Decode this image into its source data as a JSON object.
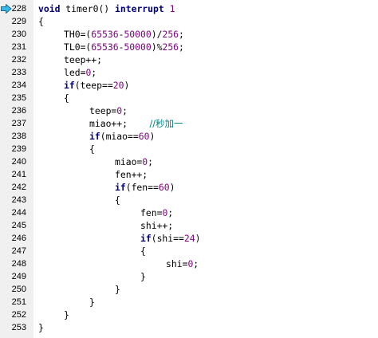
{
  "editor": {
    "current_line": "228",
    "marker_color": "#38b8e6",
    "colors": {
      "text": "#000000",
      "keyword": "#000080",
      "number": "#800080",
      "comment": "#008080",
      "gutter": "#f0f0f0"
    },
    "lines": [
      {
        "num": "228",
        "indent": 0,
        "segments": [
          {
            "t": "void",
            "c": "kw"
          },
          {
            "t": " timer0() "
          },
          {
            "t": "interrupt",
            "c": "kw"
          },
          {
            "t": " "
          },
          {
            "t": "1",
            "c": "num"
          }
        ]
      },
      {
        "num": "229",
        "indent": 0,
        "segments": [
          {
            "t": "{"
          }
        ]
      },
      {
        "num": "230",
        "indent": 1,
        "segments": [
          {
            "t": "TH0=("
          },
          {
            "t": "65536",
            "c": "num"
          },
          {
            "t": "-"
          },
          {
            "t": "50000",
            "c": "num"
          },
          {
            "t": ")/"
          },
          {
            "t": "256",
            "c": "num"
          },
          {
            "t": ";"
          }
        ]
      },
      {
        "num": "231",
        "indent": 1,
        "segments": [
          {
            "t": "TL0=("
          },
          {
            "t": "65536",
            "c": "num"
          },
          {
            "t": "-"
          },
          {
            "t": "50000",
            "c": "num"
          },
          {
            "t": ")%"
          },
          {
            "t": "256",
            "c": "num"
          },
          {
            "t": ";"
          }
        ]
      },
      {
        "num": "232",
        "indent": 1,
        "segments": [
          {
            "t": "teep++;"
          }
        ]
      },
      {
        "num": "233",
        "indent": 1,
        "segments": [
          {
            "t": "led="
          },
          {
            "t": "0",
            "c": "num"
          },
          {
            "t": ";"
          }
        ]
      },
      {
        "num": "234",
        "indent": 1,
        "segments": [
          {
            "t": "if",
            "c": "kw"
          },
          {
            "t": "(teep=="
          },
          {
            "t": "20",
            "c": "num"
          },
          {
            "t": ")"
          }
        ]
      },
      {
        "num": "235",
        "indent": 1,
        "segments": [
          {
            "t": "{"
          }
        ]
      },
      {
        "num": "236",
        "indent": 2,
        "segments": [
          {
            "t": "teep="
          },
          {
            "t": "0",
            "c": "num"
          },
          {
            "t": ";"
          }
        ]
      },
      {
        "num": "237",
        "indent": 2,
        "segments": [
          {
            "t": "miao++;    "
          },
          {
            "t": "//秒加一",
            "c": "cmt"
          }
        ]
      },
      {
        "num": "238",
        "indent": 2,
        "segments": [
          {
            "t": "if",
            "c": "kw"
          },
          {
            "t": "(miao=="
          },
          {
            "t": "60",
            "c": "num"
          },
          {
            "t": ")"
          }
        ]
      },
      {
        "num": "239",
        "indent": 2,
        "segments": [
          {
            "t": "{"
          }
        ]
      },
      {
        "num": "240",
        "indent": 3,
        "segments": [
          {
            "t": "miao="
          },
          {
            "t": "0",
            "c": "num"
          },
          {
            "t": ";"
          }
        ]
      },
      {
        "num": "241",
        "indent": 3,
        "segments": [
          {
            "t": "fen++;"
          }
        ]
      },
      {
        "num": "242",
        "indent": 3,
        "segments": [
          {
            "t": "if",
            "c": "kw"
          },
          {
            "t": "(fen=="
          },
          {
            "t": "60",
            "c": "num"
          },
          {
            "t": ")"
          }
        ]
      },
      {
        "num": "243",
        "indent": 3,
        "segments": [
          {
            "t": "{"
          }
        ]
      },
      {
        "num": "244",
        "indent": 4,
        "segments": [
          {
            "t": "fen="
          },
          {
            "t": "0",
            "c": "num"
          },
          {
            "t": ";"
          }
        ]
      },
      {
        "num": "245",
        "indent": 4,
        "segments": [
          {
            "t": "shi++;"
          }
        ]
      },
      {
        "num": "246",
        "indent": 4,
        "segments": [
          {
            "t": "if",
            "c": "kw"
          },
          {
            "t": "(shi=="
          },
          {
            "t": "24",
            "c": "num"
          },
          {
            "t": ")"
          }
        ]
      },
      {
        "num": "247",
        "indent": 4,
        "segments": [
          {
            "t": "{"
          }
        ]
      },
      {
        "num": "248",
        "indent": 5,
        "segments": [
          {
            "t": "shi="
          },
          {
            "t": "0",
            "c": "num"
          },
          {
            "t": ";"
          }
        ]
      },
      {
        "num": "249",
        "indent": 4,
        "segments": [
          {
            "t": "}"
          }
        ]
      },
      {
        "num": "250",
        "indent": 3,
        "segments": [
          {
            "t": "}"
          }
        ]
      },
      {
        "num": "251",
        "indent": 2,
        "segments": [
          {
            "t": "}"
          }
        ]
      },
      {
        "num": "252",
        "indent": 1,
        "segments": [
          {
            "t": "}"
          }
        ]
      },
      {
        "num": "253",
        "indent": 0,
        "segments": [
          {
            "t": "}"
          }
        ]
      }
    ]
  }
}
